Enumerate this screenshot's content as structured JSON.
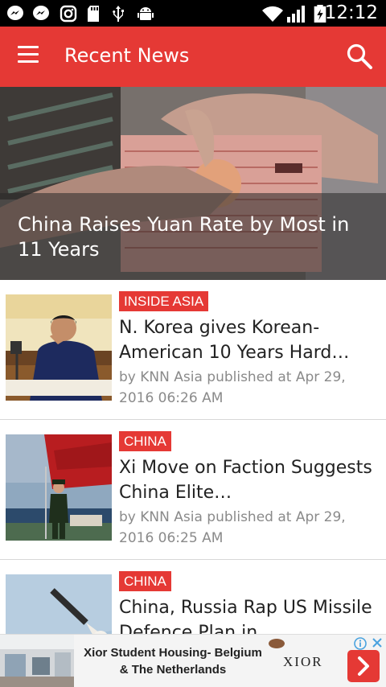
{
  "status_bar": {
    "time": "12:12",
    "icons": [
      "messenger-icon",
      "messenger-icon",
      "instagram-icon",
      "sd-card-icon",
      "usb-icon",
      "android-debug-icon",
      "wifi-icon",
      "signal-icon",
      "battery-charging-icon"
    ]
  },
  "app_bar": {
    "title": "Recent News",
    "menu_icon": "hamburger-menu-icon",
    "search_icon": "search-icon",
    "color": "#e53935"
  },
  "hero": {
    "title": "China Raises Yuan Rate by Most in 11 Years"
  },
  "articles": [
    {
      "category": "INSIDE ASIA",
      "title": "N. Korea gives Korean-American 10 Years Hard…",
      "meta": "by KNN Asia published at  Apr 29, 2016 06:26 AM"
    },
    {
      "category": "CHINA",
      "title": "Xi Move on Faction Suggests China Elite…",
      "meta": "by KNN Asia published at  Apr 29, 2016 06:25 AM"
    },
    {
      "category": "CHINA",
      "title": "China, Russia Rap US Missile Defence Plan in…",
      "meta": ""
    }
  ],
  "ad": {
    "text": "Xior Student Housing- Belgium & The Netherlands",
    "logo": "XIOR",
    "info_icon": "ad-info-icon",
    "close_icon": "close-icon",
    "cta_icon": "chevron-right-icon"
  }
}
